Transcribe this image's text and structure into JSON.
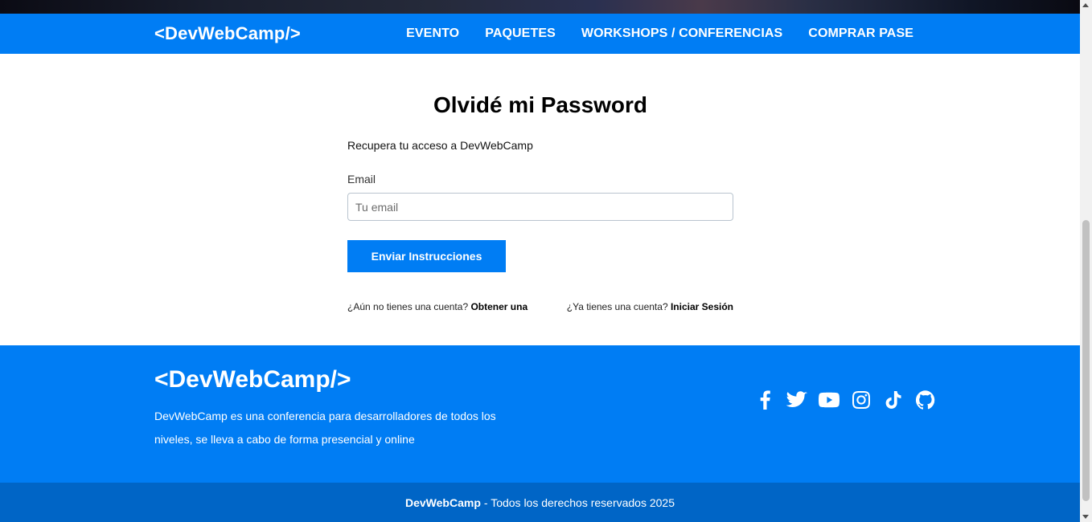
{
  "header": {
    "brand": "<DevWebCamp/>",
    "nav": [
      {
        "label": "EVENTO"
      },
      {
        "label": "PAQUETES"
      },
      {
        "label": "WORKSHOPS / CONFERENCIAS"
      },
      {
        "label": "COMPRAR PASE"
      }
    ]
  },
  "main": {
    "title": "Olvidé mi Password",
    "description": "Recupera tu acceso a DevWebCamp",
    "email_label": "Email",
    "email_placeholder": "Tu email",
    "email_value": "",
    "submit_label": "Enviar Instrucciones",
    "links": {
      "register_text": "¿Aún no tienes una cuenta?",
      "register_link": "Obtener una",
      "login_text": "¿Ya tienes una cuenta?",
      "login_link": "Iniciar Sesión"
    }
  },
  "footer": {
    "brand": "<DevWebCamp/>",
    "description": "DevWebCamp es una conferencia para desarrolladores de todos los niveles, se lleva a cabo de forma presencial y online",
    "socials": [
      "facebook-icon",
      "twitter-icon",
      "youtube-icon",
      "instagram-icon",
      "tiktok-icon",
      "github-icon"
    ],
    "copyright_brand": "DevWebCamp",
    "copyright_text": "- Todos los derechos reservados 2025"
  },
  "colors": {
    "primary": "#007df4",
    "primary_dark": "#0065c6"
  }
}
